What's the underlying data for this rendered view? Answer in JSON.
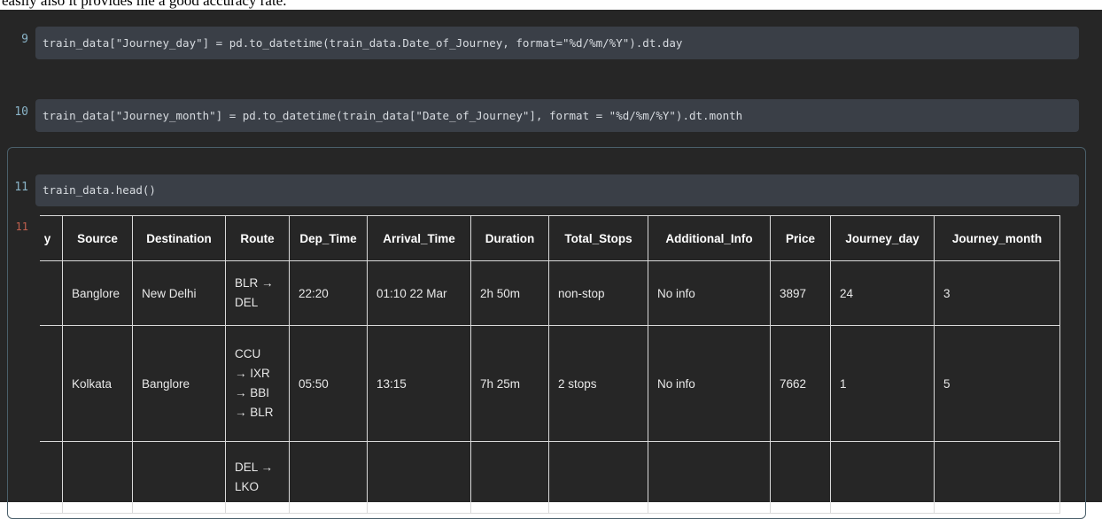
{
  "doc_text": "easily also it provides me a good accuracy rate.",
  "cells": [
    {
      "num": "9",
      "code": "train_data[\"Journey_day\"] = pd.to_datetime(train_data.Date_of_Journey, format=\"%d/%m/%Y\").dt.day"
    },
    {
      "num": "10",
      "code": "train_data[\"Journey_month\"] = pd.to_datetime(train_data[\"Date_of_Journey\"], format = \"%d/%m/%Y\").dt.month"
    },
    {
      "num": "11",
      "code": "train_data.head()"
    }
  ],
  "output": {
    "num": "11",
    "columns": [
      "y",
      "Source",
      "Destination",
      "Route",
      "Dep_Time",
      "Arrival_Time",
      "Duration",
      "Total_Stops",
      "Additional_Info",
      "Price",
      "Journey_day",
      "Journey_month"
    ],
    "rows": [
      [
        "",
        "Banglore",
        "New Delhi",
        "BLR →\nDEL",
        "22:20",
        "01:10 22 Mar",
        "2h 50m",
        "non-stop",
        "No info",
        "3897",
        "24",
        "3"
      ],
      [
        "",
        "Kolkata",
        "Banglore",
        "CCU\n→ IXR\n→ BBI\n→ BLR",
        "05:50",
        "13:15",
        "7h 25m",
        "2 stops",
        "No info",
        "7662",
        "1",
        "5"
      ],
      [
        "",
        "",
        "",
        "DEL →\nLKO",
        "",
        "",
        "",
        "",
        "",
        "",
        "",
        ""
      ]
    ]
  },
  "colors": {
    "background": "#262626",
    "code_cell": "#3a3f47",
    "exec_count": "#8ab4c8",
    "out_count": "#c0604e"
  }
}
